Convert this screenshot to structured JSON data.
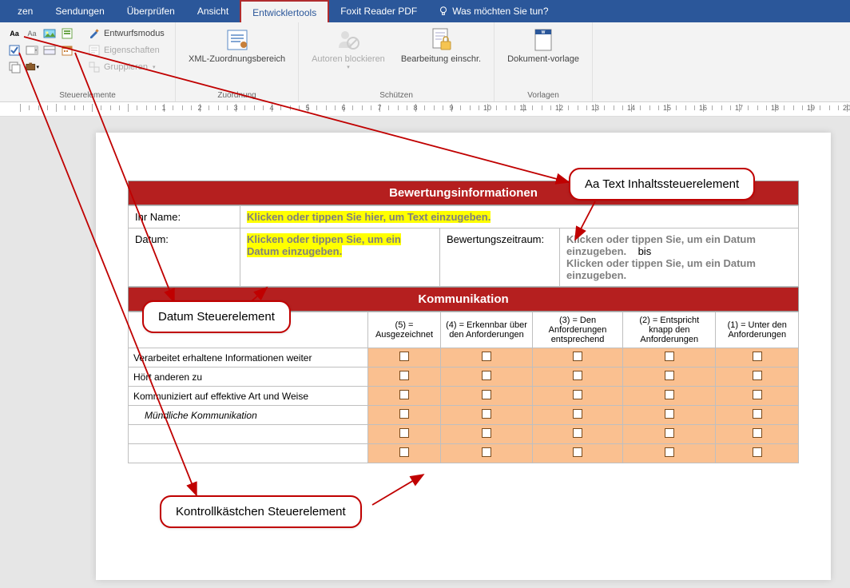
{
  "ribbon": {
    "tabs": [
      "zen",
      "Sendungen",
      "Überprüfen",
      "Ansicht",
      "Entwicklertools",
      "Foxit Reader PDF"
    ],
    "active_tab": "Entwicklertools",
    "tellme": "Was möchten Sie tun?"
  },
  "groups": {
    "controls_label": "Steuerelemente",
    "design_mode": "Entwurfsmodus",
    "properties": "Eigenschaften",
    "group": "Gruppieren",
    "mapping_label": "Zuordnung",
    "xml_mapping": "XML-Zuordnungsbereich",
    "protect_label": "Schützen",
    "block_authors": "Autoren blockieren",
    "restrict_edit": "Bearbeitung einschr.",
    "templates_label": "Vorlagen",
    "doc_template": "Dokument-vorlage"
  },
  "doc": {
    "section1": "Bewertungsinformationen",
    "name_label": "Ihr Name:",
    "name_placeholder": "Klicken oder tippen Sie hier, um Text einzugeben.",
    "date_label": "Datum:",
    "date_placeholder": "Klicken oder tippen Sie, um ein Datum einzugeben.",
    "period_label": "Bewertungszeitraum:",
    "period_text1": "Klicken oder tippen Sie, um ein Datum einzugeben.",
    "period_bis": "bis",
    "period_text2": "Klicken oder tippen Sie, um ein Datum einzugeben.",
    "section2": "Kommunikation",
    "cols": [
      "(5) = Ausgezeichnet",
      "(4) = Erkennbar über den Anforderungen",
      "(3) = Den Anforderungen entsprechend",
      "(2) = Entspricht knapp den Anforderungen",
      "(1) = Unter den Anforderungen"
    ],
    "rows": [
      {
        "label": "Verarbeitet erhaltene Informationen weiter",
        "italic": false
      },
      {
        "label": "Hört anderen zu",
        "italic": false
      },
      {
        "label": "Kommuniziert auf effektive Art und Weise",
        "italic": false
      },
      {
        "label": "Mündliche Kommunikation",
        "italic": true
      },
      {
        "label": "",
        "italic": false
      },
      {
        "label": "",
        "italic": false
      }
    ]
  },
  "callouts": {
    "text_ctrl": "Aa Text Inhaltssteuerelement",
    "date_ctrl": "Datum Steuerelement",
    "checkbox_ctrl": "Kontrollkästchen Steuerelement"
  }
}
